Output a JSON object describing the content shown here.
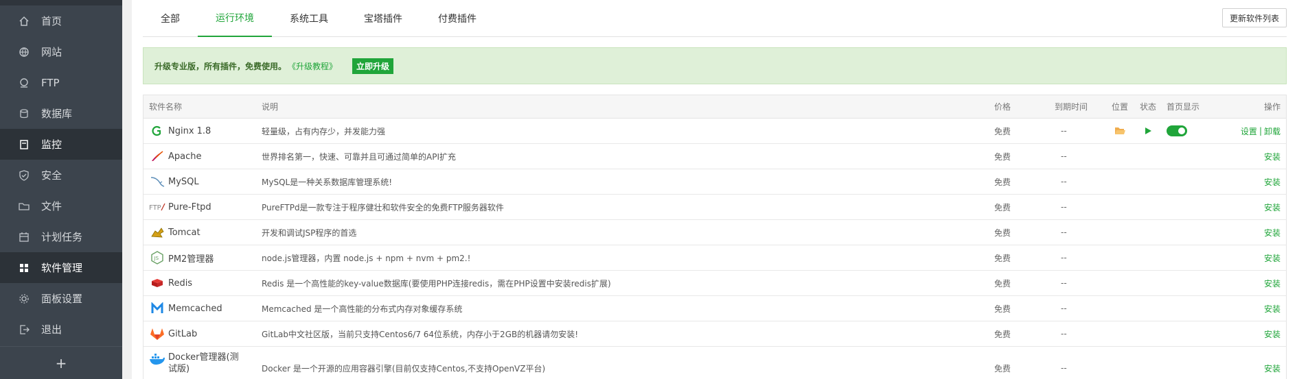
{
  "sidebar": {
    "items": [
      {
        "label": "首页",
        "icon": "home-icon"
      },
      {
        "label": "网站",
        "icon": "globe-icon"
      },
      {
        "label": "FTP",
        "icon": "ftp-icon"
      },
      {
        "label": "数据库",
        "icon": "database-icon"
      },
      {
        "label": "监控",
        "icon": "monitor-icon"
      },
      {
        "label": "安全",
        "icon": "shield-icon"
      },
      {
        "label": "文件",
        "icon": "folder-icon"
      },
      {
        "label": "计划任务",
        "icon": "calendar-icon"
      },
      {
        "label": "软件管理",
        "icon": "grid-icon"
      },
      {
        "label": "面板设置",
        "icon": "gear-icon"
      },
      {
        "label": "退出",
        "icon": "logout-icon"
      }
    ],
    "add_label": "+"
  },
  "tabs": [
    "全部",
    "运行环境",
    "系统工具",
    "宝塔插件",
    "付费插件"
  ],
  "active_tab": "运行环境",
  "refresh_label": "更新软件列表",
  "banner": {
    "text": "升级专业版，所有插件，免费使用。",
    "link": "《升级教程》",
    "button": "立即升级"
  },
  "table": {
    "headers": {
      "name": "软件名称",
      "desc": "说明",
      "price": "价格",
      "expire": "到期时间",
      "location": "位置",
      "status": "状态",
      "home": "首页显示",
      "op": "操作"
    },
    "rows": [
      {
        "name": "Nginx 1.8",
        "logo": "nginx-logo",
        "desc": "轻量级，占有内存少，并发能力强",
        "price": "免费",
        "expire": "--",
        "installed": true,
        "op1": "设置",
        "op2": "卸载"
      },
      {
        "name": "Apache",
        "logo": "apache-logo",
        "desc": "世界排名第一，快速、可靠并且可通过简单的API扩充",
        "price": "免费",
        "expire": "--",
        "op": "安装"
      },
      {
        "name": "MySQL",
        "logo": "mysql-logo",
        "desc": "MySQL是一种关系数据库管理系统!",
        "price": "免费",
        "expire": "--",
        "op": "安装"
      },
      {
        "name": "Pure-Ftpd",
        "logo": "ftp-logo",
        "desc": "PureFTPd是一款专注于程序健壮和软件安全的免费FTP服务器软件",
        "price": "免费",
        "expire": "--",
        "op": "安装"
      },
      {
        "name": "Tomcat",
        "logo": "tomcat-logo",
        "desc": "开发和调试JSP程序的首选",
        "price": "免费",
        "expire": "--",
        "op": "安装"
      },
      {
        "name": "PM2管理器",
        "logo": "nodejs-logo",
        "desc": "node.js管理器，内置 node.js + npm + nvm + pm2.!",
        "price": "免费",
        "expire": "--",
        "op": "安装"
      },
      {
        "name": "Redis",
        "logo": "redis-logo",
        "desc": "Redis 是一个高性能的key-value数据库(要使用PHP连接redis，需在PHP设置中安装redis扩展)",
        "price": "免费",
        "expire": "--",
        "op": "安装"
      },
      {
        "name": "Memcached",
        "logo": "memcached-logo",
        "desc": "Memcached 是一个高性能的分布式内存对象缓存系统",
        "price": "免费",
        "expire": "--",
        "op": "安装"
      },
      {
        "name": "GitLab",
        "logo": "gitlab-logo",
        "desc": "GitLab中文社区版，当前只支持Centos6/7 64位系统，内存小于2GB的机器请勿安装!",
        "price": "免费",
        "expire": "--",
        "op": "安装"
      },
      {
        "name": "Docker管理器(测试版)",
        "logo": "docker-logo",
        "desc": "Docker 是一个开源的应用容器引擎(目前仅支持Centos,不支持OpenVZ平台)",
        "price": "免费",
        "expire": "--",
        "op": "安装"
      }
    ]
  },
  "colors": {
    "accent": "#20a53a",
    "sidebar": "#3c444d"
  }
}
